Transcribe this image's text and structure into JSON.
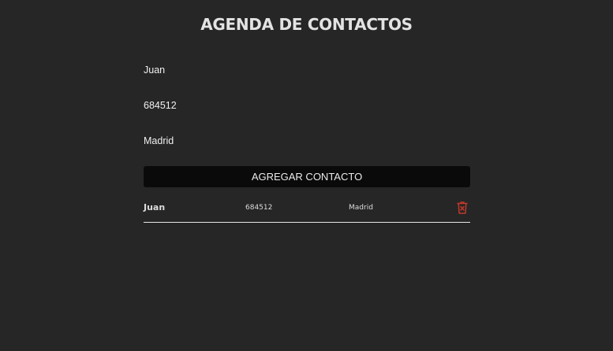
{
  "header": {
    "title": "AGENDA DE CONTACTOS"
  },
  "form": {
    "name_value": "Juan",
    "phone_value": "684512",
    "city_value": "Madrid",
    "add_button_label": "AGREGAR CONTACTO"
  },
  "contacts": [
    {
      "name": "Juan",
      "phone": "684512",
      "city": "Madrid",
      "delete_icon": "trash-x-icon"
    }
  ],
  "colors": {
    "background": "#262626",
    "button_bg": "#0a0a0a",
    "delete_icon": "#c0392b"
  }
}
